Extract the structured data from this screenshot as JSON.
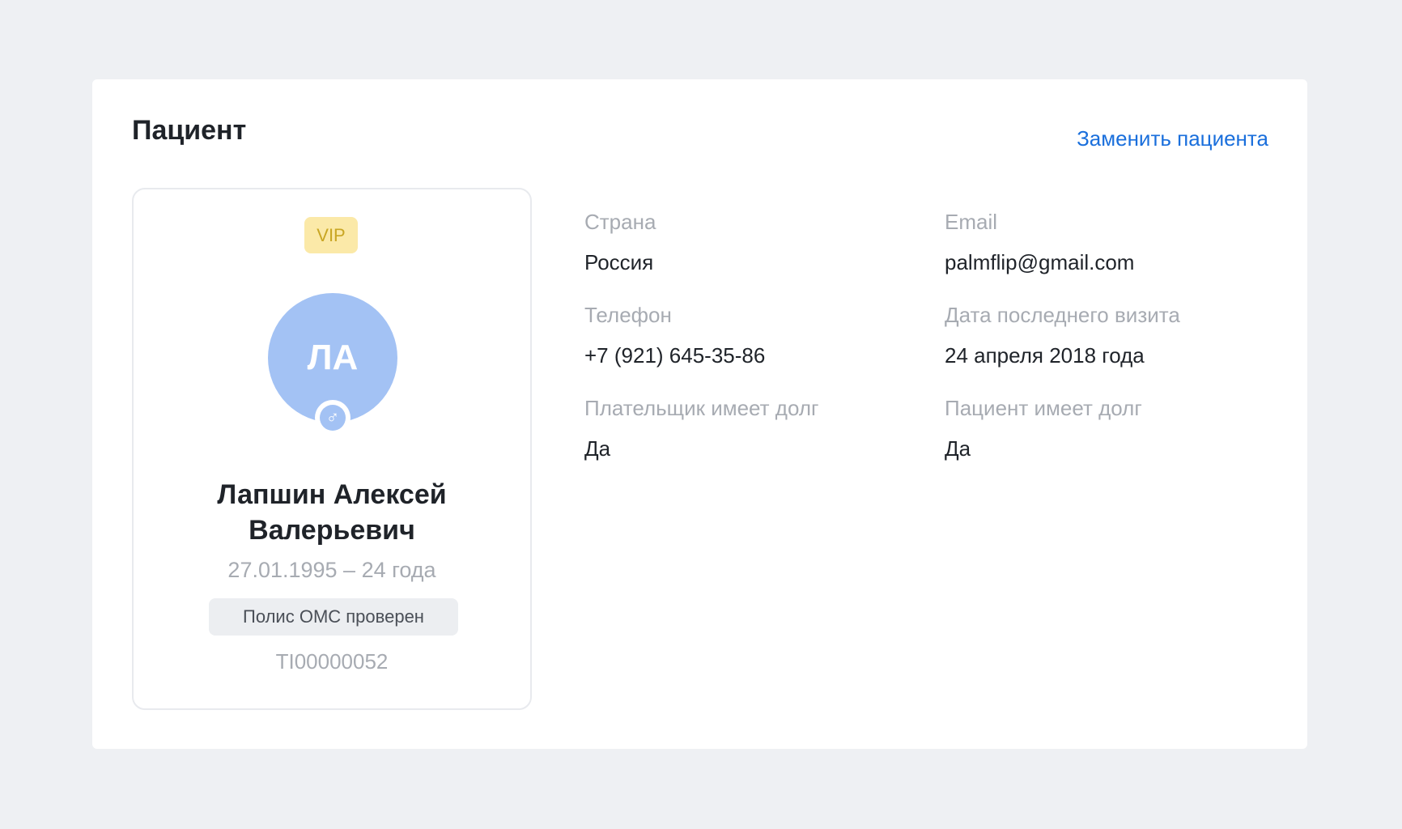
{
  "header": {
    "title": "Пациент",
    "replace_link": "Заменить пациента"
  },
  "profile": {
    "badge": "VIP",
    "initials": "ЛА",
    "gender_symbol": "♂",
    "name_line1": "Лапшин Алексей",
    "name_line2": "Валерьевич",
    "birth_age": "27.01.1995 – 24 года",
    "oms_status": "Полис ОМС проверен",
    "patient_id": "TI00000052"
  },
  "fields": {
    "country": {
      "label": "Страна",
      "value": "Россия"
    },
    "email": {
      "label": "Email",
      "value": "palmflip@gmail.com"
    },
    "phone": {
      "label": "Телефон",
      "value": "+7 (921) 645-35-86"
    },
    "last_visit": {
      "label": "Дата последнего визита",
      "value": "24 апреля 2018 года"
    },
    "payer_debt": {
      "label": "Плательщик имеет долг",
      "value": "Да"
    },
    "patient_debt": {
      "label": "Пациент имеет долг",
      "value": "Да"
    }
  },
  "colors": {
    "background": "#eef0f3",
    "card": "#ffffff",
    "accent_link": "#1a6fdc",
    "avatar": "#a3c2f4",
    "vip_bg": "#fbe9a8",
    "vip_text": "#c9a623",
    "muted_text": "#a7abb2",
    "primary_text": "#1f2329"
  }
}
